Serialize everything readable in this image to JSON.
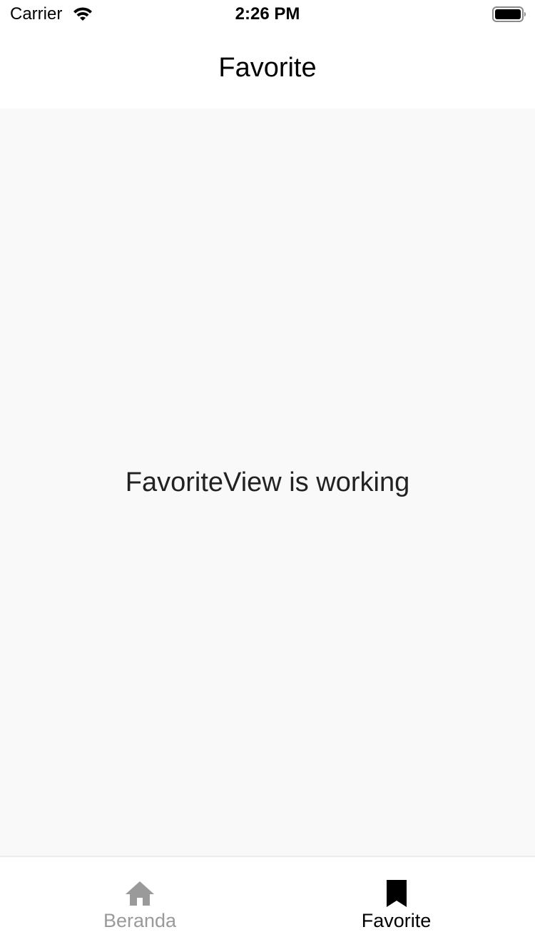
{
  "status_bar": {
    "carrier": "Carrier",
    "time": "2:26 PM",
    "wifi_icon": "wifi-icon",
    "battery_icon": "battery-icon"
  },
  "nav": {
    "title": "Favorite"
  },
  "content": {
    "message": "FavoriteView is working"
  },
  "tab_bar": {
    "tabs": [
      {
        "label": "Beranda",
        "icon": "home-icon",
        "active": false,
        "color": "#9a9a9a"
      },
      {
        "label": "Favorite",
        "icon": "bookmark-icon",
        "active": true,
        "color": "#000000"
      }
    ]
  },
  "colors": {
    "background": "#ffffff",
    "content_background": "#f9f9f9",
    "active_tab": "#000000",
    "inactive_tab": "#9a9a9a"
  }
}
